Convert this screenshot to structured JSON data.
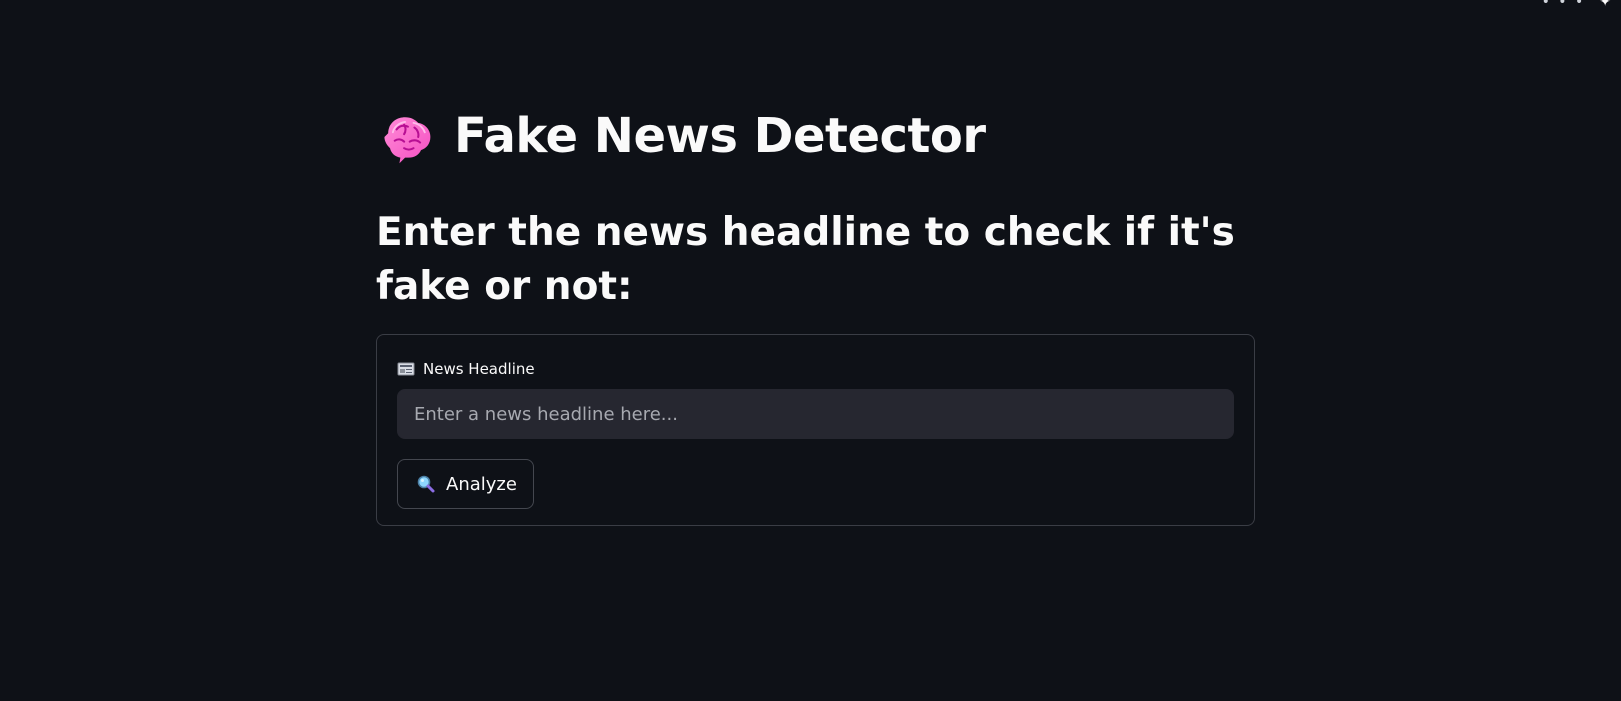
{
  "header": {
    "title": "Fake News Detector",
    "title_icon": "brain-icon",
    "subtitle": "Enter the news headline to check if it's fake or not:"
  },
  "form": {
    "label": "News Headline",
    "label_icon": "newspaper-icon",
    "input_value": "",
    "input_placeholder": "Enter a news headline here...",
    "button_label": "Analyze",
    "button_icon": "magnifier-icon"
  },
  "top_bar": {
    "more_icon": "more-icon",
    "settings_icon": "settings-icon"
  },
  "colors": {
    "background": "#0e1117",
    "input_background": "#262730",
    "border": "#3a3d45",
    "text": "#fafafa",
    "placeholder": "#a7a9b0"
  }
}
